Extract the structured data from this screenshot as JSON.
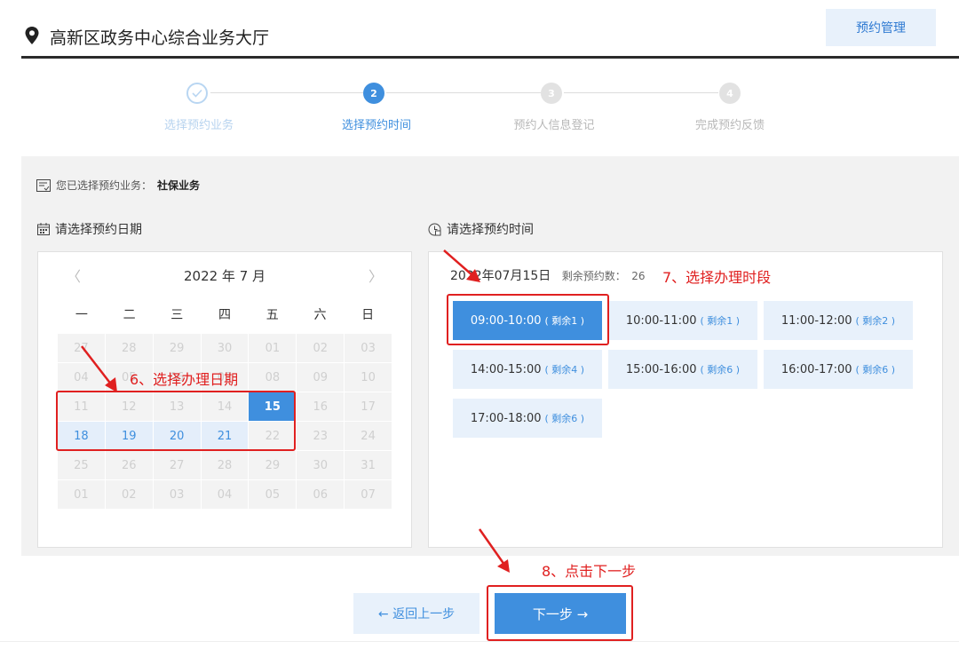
{
  "header": {
    "title": "高新区政务中心综合业务大厅",
    "manage_label": "预约管理"
  },
  "steps": [
    {
      "num": "✓",
      "label": "选择预约业务",
      "state": "done"
    },
    {
      "num": "2",
      "label": "选择预约时间",
      "state": "active"
    },
    {
      "num": "3",
      "label": "预约人信息登记",
      "state": "todo"
    },
    {
      "num": "4",
      "label": "完成预约反馈",
      "state": "todo"
    }
  ],
  "service": {
    "prefix": "您已选择预约业务：",
    "name": "社保业务"
  },
  "date_section": {
    "title": "请选择预约日期"
  },
  "time_section": {
    "title": "请选择预约时间"
  },
  "calendar": {
    "prev": "〈",
    "next": "〉",
    "month_label": "2022 年 7 月",
    "weekdays": [
      "一",
      "二",
      "三",
      "四",
      "五",
      "六",
      "日"
    ],
    "days": [
      {
        "d": "27",
        "s": "disabled"
      },
      {
        "d": "28",
        "s": "disabled"
      },
      {
        "d": "29",
        "s": "disabled"
      },
      {
        "d": "30",
        "s": "disabled"
      },
      {
        "d": "01",
        "s": "disabled"
      },
      {
        "d": "02",
        "s": "disabled"
      },
      {
        "d": "03",
        "s": "disabled"
      },
      {
        "d": "04",
        "s": "disabled"
      },
      {
        "d": "05",
        "s": "disabled"
      },
      {
        "d": "06",
        "s": "disabled"
      },
      {
        "d": "07",
        "s": "disabled"
      },
      {
        "d": "08",
        "s": "disabled"
      },
      {
        "d": "09",
        "s": "disabled"
      },
      {
        "d": "10",
        "s": "disabled"
      },
      {
        "d": "11",
        "s": "disabled"
      },
      {
        "d": "12",
        "s": "disabled"
      },
      {
        "d": "13",
        "s": "disabled"
      },
      {
        "d": "14",
        "s": "disabled"
      },
      {
        "d": "15",
        "s": "selected"
      },
      {
        "d": "16",
        "s": "disabled"
      },
      {
        "d": "17",
        "s": "disabled"
      },
      {
        "d": "18",
        "s": "avail"
      },
      {
        "d": "19",
        "s": "avail"
      },
      {
        "d": "20",
        "s": "avail"
      },
      {
        "d": "21",
        "s": "avail"
      },
      {
        "d": "22",
        "s": "disabled"
      },
      {
        "d": "23",
        "s": "disabled"
      },
      {
        "d": "24",
        "s": "disabled"
      },
      {
        "d": "25",
        "s": "disabled"
      },
      {
        "d": "26",
        "s": "disabled"
      },
      {
        "d": "27",
        "s": "disabled"
      },
      {
        "d": "28",
        "s": "disabled"
      },
      {
        "d": "29",
        "s": "disabled"
      },
      {
        "d": "30",
        "s": "disabled"
      },
      {
        "d": "31",
        "s": "disabled"
      },
      {
        "d": "01",
        "s": "disabled"
      },
      {
        "d": "02",
        "s": "disabled"
      },
      {
        "d": "03",
        "s": "disabled"
      },
      {
        "d": "04",
        "s": "disabled"
      },
      {
        "d": "05",
        "s": "disabled"
      },
      {
        "d": "06",
        "s": "disabled"
      },
      {
        "d": "07",
        "s": "disabled"
      }
    ]
  },
  "time_panel": {
    "date_label": "2022年07月15日",
    "remaining_label": "剩余预约数：",
    "remaining_value": "26",
    "slots": [
      {
        "time": "09:00-10:00",
        "left": "( 剩余1 )",
        "selected": true
      },
      {
        "time": "10:00-11:00",
        "left": "( 剩余1 )",
        "selected": false
      },
      {
        "time": "11:00-12:00",
        "left": "( 剩余2 )",
        "selected": false
      },
      {
        "time": "14:00-15:00",
        "left": "( 剩余4 )",
        "selected": false
      },
      {
        "time": "15:00-16:00",
        "left": "( 剩余6 )",
        "selected": false
      },
      {
        "time": "16:00-17:00",
        "left": "( 剩余6 )",
        "selected": false
      },
      {
        "time": "17:00-18:00",
        "left": "( 剩余6 )",
        "selected": false
      }
    ]
  },
  "buttons": {
    "back": "← 返回上一步",
    "next": "下一步 →"
  },
  "annotations": {
    "step6": "6、选择办理日期",
    "step7": "7、选择办理时段",
    "step8": "8、点击下一步"
  },
  "colors": {
    "accent": "#3f8fde",
    "light": "#e8f1fb",
    "annotation": "#e02020"
  }
}
